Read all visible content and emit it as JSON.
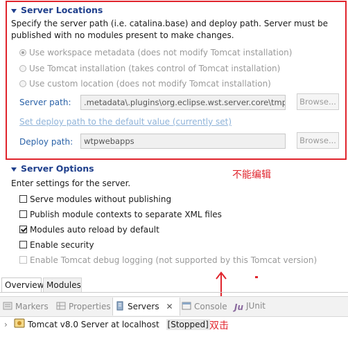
{
  "server_locations": {
    "title": "Server Locations",
    "description_line1": "Specify the server path (i.e. catalina.base) and deploy path. Server must be",
    "description_line2": "published with no modules present to make changes.",
    "options": [
      "Use workspace metadata (does not modify Tomcat installation)",
      "Use Tomcat installation (takes control of Tomcat installation)",
      "Use custom location (does not modify Tomcat installation)"
    ],
    "server_path_label": "Server path:",
    "server_path_value": ".metadata\\.plugins\\org.eclipse.wst.server.core\\tmp",
    "browse_label": "Browse...",
    "default_deploy_link": "Set deploy path to the default value (currently set)",
    "deploy_path_label": "Deploy path:",
    "deploy_path_value": "wtpwebapps"
  },
  "server_options": {
    "title": "Server Options",
    "description": "Enter settings for the server.",
    "checkboxes": [
      {
        "label": "Serve modules without publishing",
        "checked": false
      },
      {
        "label": "Publish module contexts to separate XML files",
        "checked": false
      },
      {
        "label": "Modules auto reload by default",
        "checked": true
      },
      {
        "label": "Enable security",
        "checked": false
      },
      {
        "label": "Enable Tomcat debug logging (not supported by this Tomcat version)",
        "checked": false
      }
    ]
  },
  "annotations": {
    "not_editable": "不能编辑",
    "double_click": "双击"
  },
  "editor_tabs": [
    "Overview",
    "Modules"
  ],
  "view_tabs": [
    "Markers",
    "Properties",
    "Servers",
    "Console",
    "JUnit"
  ],
  "server_entry": {
    "name": "Tomcat v8.0 Server at localhost",
    "status": "[Stopped]"
  },
  "colors": {
    "annotation_red": "#e0242c",
    "section_title_blue": "#1f3f8c"
  }
}
